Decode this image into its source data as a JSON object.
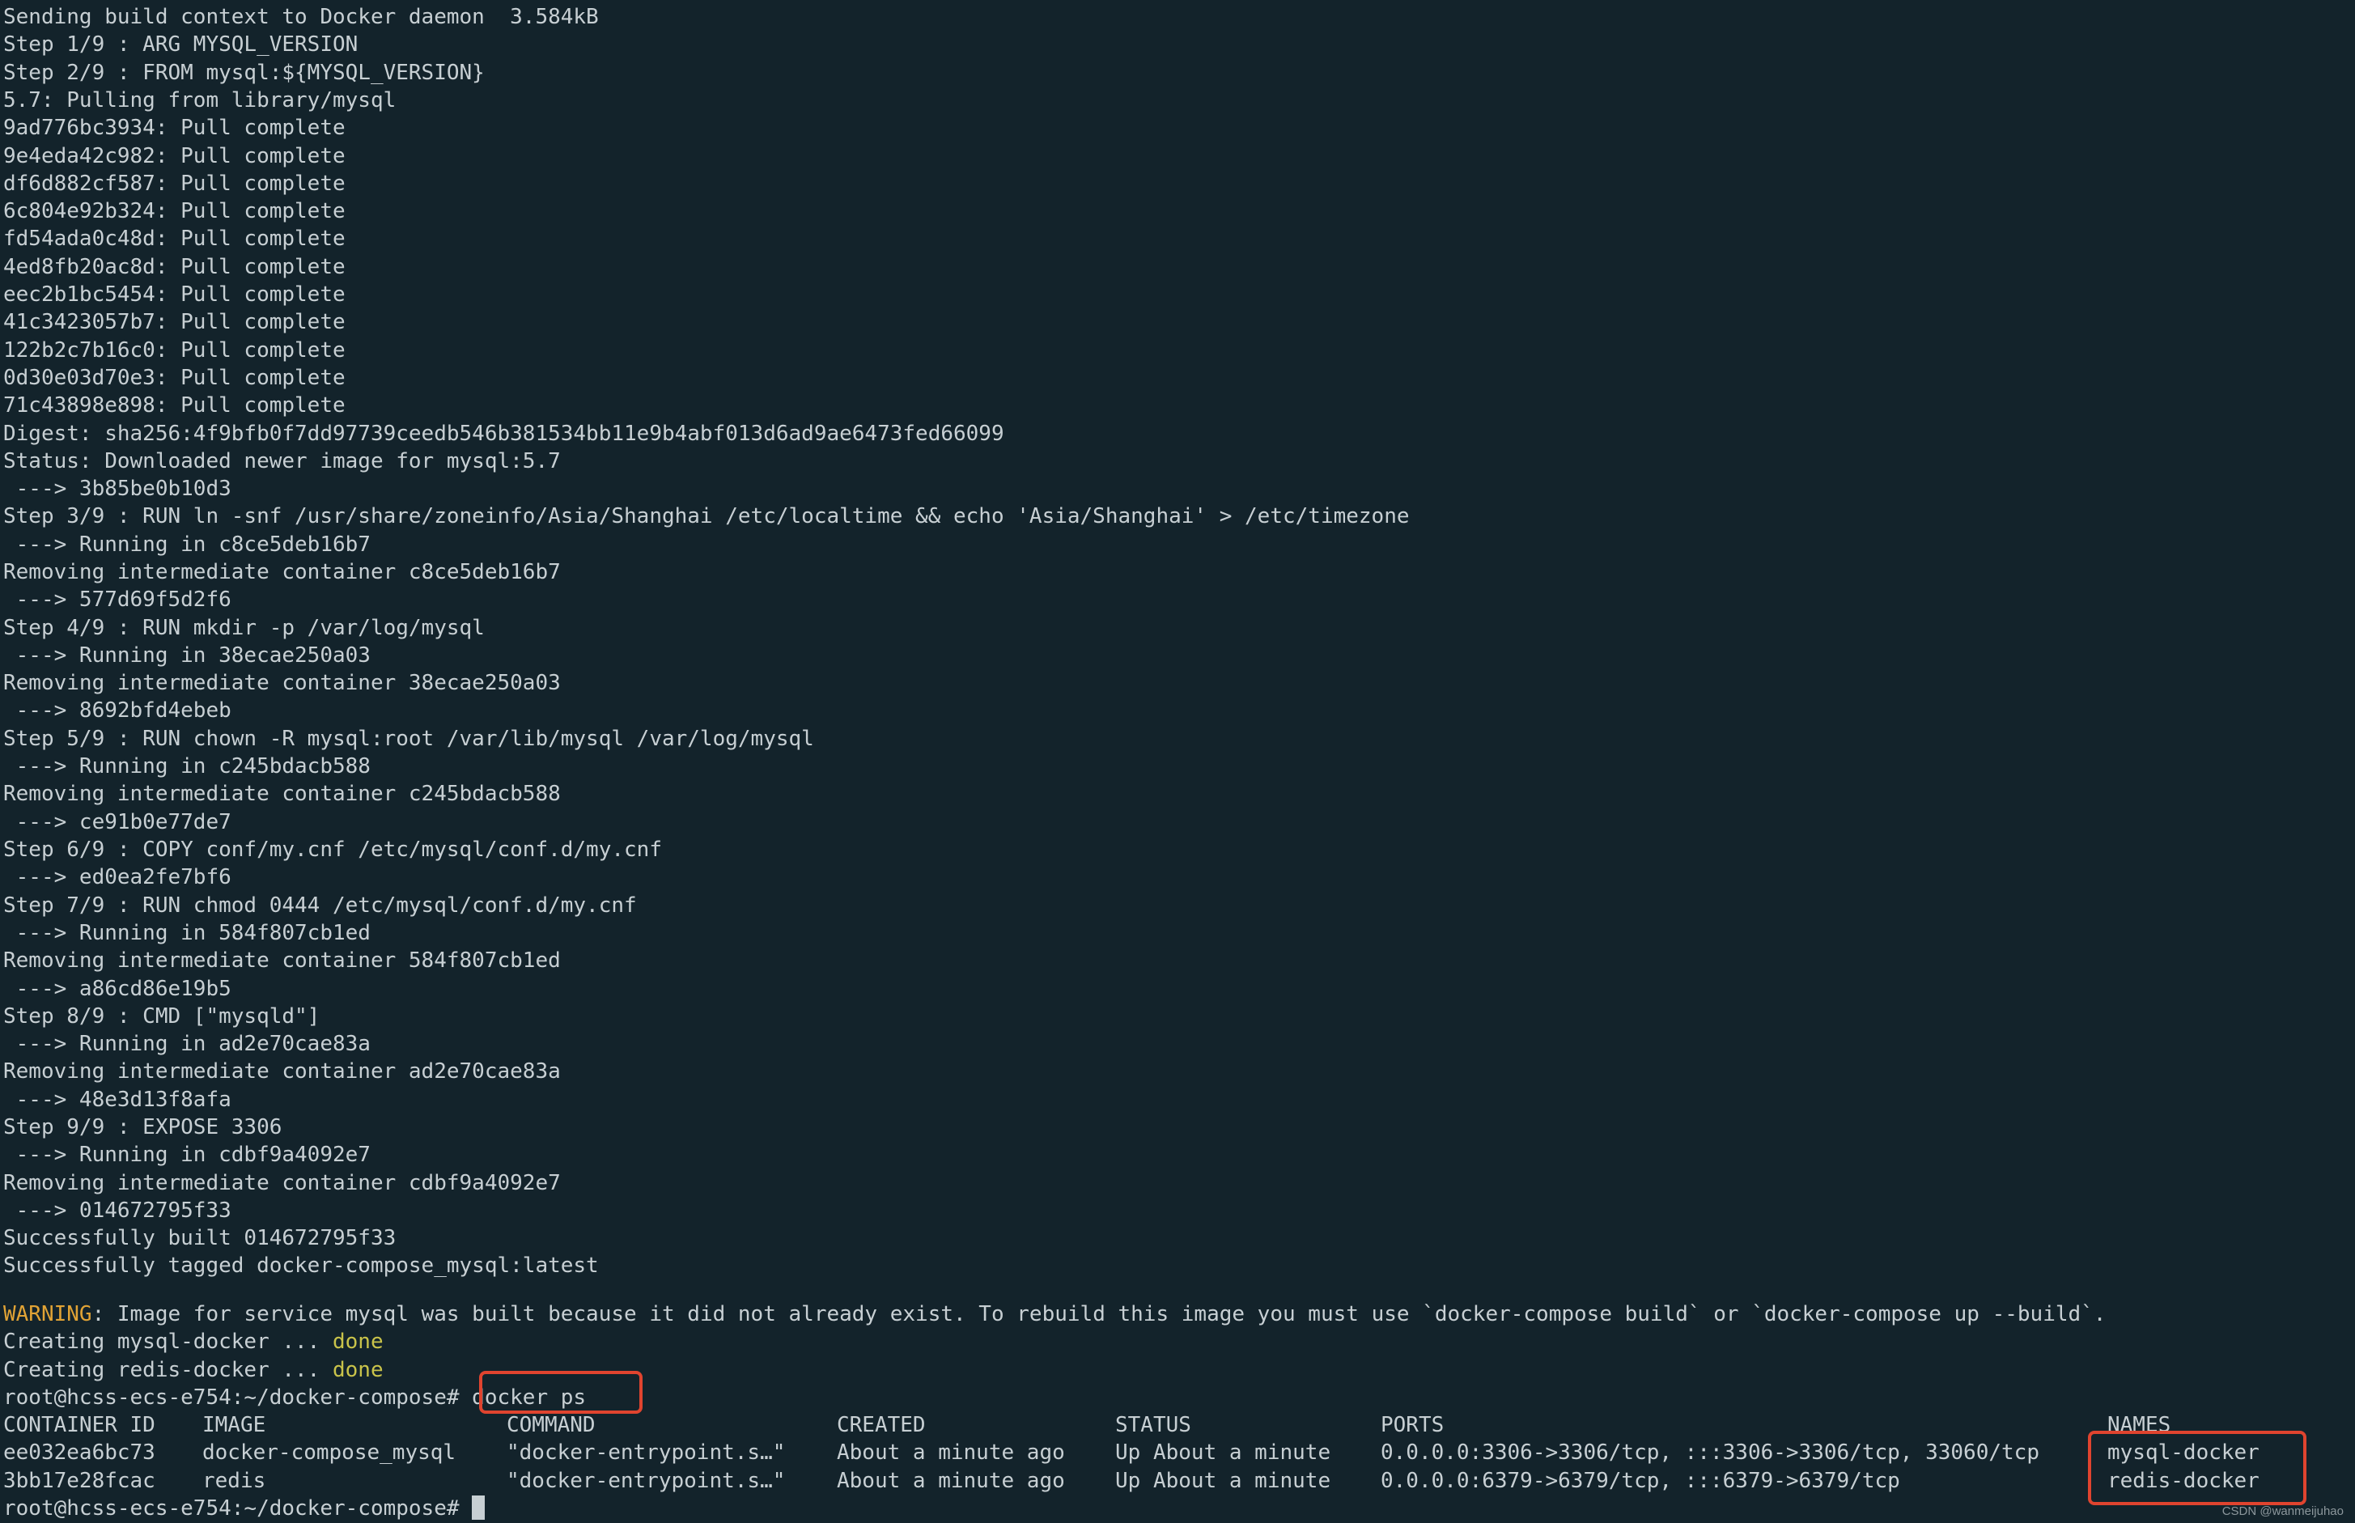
{
  "build_lines": [
    "Sending build context to Docker daemon  3.584kB",
    "Step 1/9 : ARG MYSQL_VERSION",
    "Step 2/9 : FROM mysql:${MYSQL_VERSION}",
    "5.7: Pulling from library/mysql",
    "9ad776bc3934: Pull complete",
    "9e4eda42c982: Pull complete",
    "df6d882cf587: Pull complete",
    "6c804e92b324: Pull complete",
    "fd54ada0c48d: Pull complete",
    "4ed8fb20ac8d: Pull complete",
    "eec2b1bc5454: Pull complete",
    "41c3423057b7: Pull complete",
    "122b2c7b16c0: Pull complete",
    "0d30e03d70e3: Pull complete",
    "71c43898e898: Pull complete",
    "Digest: sha256:4f9bfb0f7dd97739ceedb546b381534bb11e9b4abf013d6ad9ae6473fed66099",
    "Status: Downloaded newer image for mysql:5.7",
    " ---> 3b85be0b10d3",
    "Step 3/9 : RUN ln -snf /usr/share/zoneinfo/Asia/Shanghai /etc/localtime && echo 'Asia/Shanghai' > /etc/timezone",
    " ---> Running in c8ce5deb16b7",
    "Removing intermediate container c8ce5deb16b7",
    " ---> 577d69f5d2f6",
    "Step 4/9 : RUN mkdir -p /var/log/mysql",
    " ---> Running in 38ecae250a03",
    "Removing intermediate container 38ecae250a03",
    " ---> 8692bfd4ebeb",
    "Step 5/9 : RUN chown -R mysql:root /var/lib/mysql /var/log/mysql",
    " ---> Running in c245bdacb588",
    "Removing intermediate container c245bdacb588",
    " ---> ce91b0e77de7",
    "Step 6/9 : COPY conf/my.cnf /etc/mysql/conf.d/my.cnf",
    " ---> ed0ea2fe7bf6",
    "Step 7/9 : RUN chmod 0444 /etc/mysql/conf.d/my.cnf",
    " ---> Running in 584f807cb1ed",
    "Removing intermediate container 584f807cb1ed",
    " ---> a86cd86e19b5",
    "Step 8/9 : CMD [\"mysqld\"]",
    " ---> Running in ad2e70cae83a",
    "Removing intermediate container ad2e70cae83a",
    " ---> 48e3d13f8afa",
    "Step 9/9 : EXPOSE 3306",
    " ---> Running in cdbf9a4092e7",
    "Removing intermediate container cdbf9a4092e7",
    " ---> 014672795f33",
    "Successfully built 014672795f33",
    "Successfully tagged docker-compose_mysql:latest"
  ],
  "warning": {
    "label": "WARNING",
    "text": ": Image for service mysql was built because it did not already exist. To rebuild this image you must use `docker-compose build` or `docker-compose up --build`."
  },
  "creating": [
    {
      "prefix": "Creating mysql-docker ... ",
      "status": "done"
    },
    {
      "prefix": "Creating redis-docker ... ",
      "status": "done"
    }
  ],
  "prompt": {
    "text": "root@hcss-ecs-e754:~/docker-compose#",
    "command": " docker ps"
  },
  "docker_ps": {
    "headers": [
      "CONTAINER ID",
      "IMAGE",
      "COMMAND",
      "CREATED",
      "STATUS",
      "PORTS",
      "NAMES"
    ],
    "rows": [
      [
        "ee032ea6bc73",
        "docker-compose_mysql",
        "\"docker-entrypoint.s…\"",
        "About a minute ago",
        "Up About a minute",
        "0.0.0.0:3306->3306/tcp, :::3306->3306/tcp, 33060/tcp",
        "mysql-docker"
      ],
      [
        "3bb17e28fcac",
        "redis",
        "\"docker-entrypoint.s…\"",
        "About a minute ago",
        "Up About a minute",
        "0.0.0.0:6379->6379/tcp, :::6379->6379/tcp",
        "redis-docker"
      ]
    ]
  },
  "final_prompt": "root@hcss-ecs-e754:~/docker-compose#",
  "watermark": "CSDN @wanmeijuhao",
  "colors": {
    "background": "#13232b",
    "text": "#c7cfd3",
    "warning": "#e1a335",
    "done": "#c9c34a",
    "highlight": "#e0442f"
  }
}
